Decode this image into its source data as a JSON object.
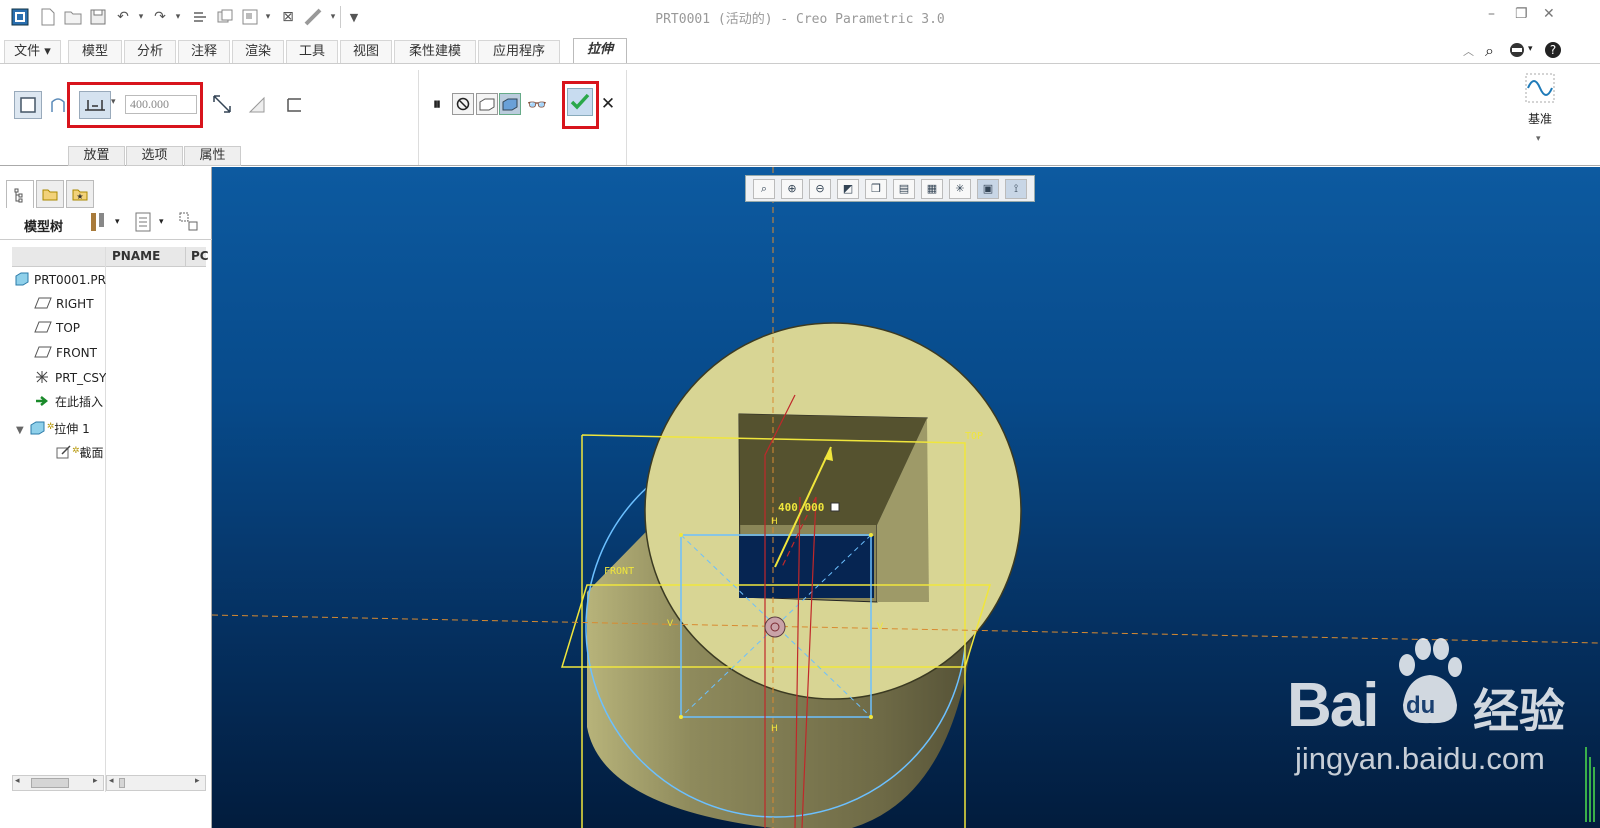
{
  "window": {
    "title": "PRT0001 (活动的) - Creo Parametric 3.0"
  },
  "tabs": [
    {
      "label": "文件 ▾"
    },
    {
      "label": "模型"
    },
    {
      "label": "分析"
    },
    {
      "label": "注释"
    },
    {
      "label": "渲染"
    },
    {
      "label": "工具"
    },
    {
      "label": "视图"
    },
    {
      "label": "柔性建模"
    },
    {
      "label": "应用程序"
    },
    {
      "label": "拉伸"
    }
  ],
  "ribbon": {
    "depth_value": "400.000",
    "group_tabs": [
      {
        "label": "放置"
      },
      {
        "label": "选项"
      },
      {
        "label": "属性"
      }
    ],
    "datum_label": "基准"
  },
  "left_panel": {
    "tree_label": "模型树",
    "columns": [
      {
        "label": "PNAME"
      },
      {
        "label": "PC"
      }
    ],
    "items": [
      {
        "label": "PRT0001.PR"
      },
      {
        "label": "RIGHT"
      },
      {
        "label": "TOP"
      },
      {
        "label": "FRONT"
      },
      {
        "label": "PRT_CSY"
      },
      {
        "label": "在此插入"
      },
      {
        "label": "拉伸 1"
      },
      {
        "label": "截面"
      }
    ]
  },
  "viewport": {
    "dimension_label": "400.000",
    "plane_labels": {
      "top": "TOP",
      "front": "FRONT"
    },
    "constraint_marks": {
      "h": "H",
      "v": "V"
    },
    "watermark": {
      "brand": "Bai",
      "du": "du",
      "cn": "经验",
      "url": "jingyan.baidu.com"
    }
  },
  "colors": {
    "highlight_red": "#d8141c",
    "viewport_top": "#0d5aa0",
    "viewport_bottom": "#021c3d",
    "model_yellow": "#d8d594",
    "sketch_yellow": "#f0e63c",
    "sketch_blue": "#6cc0ff",
    "confirm_green": "#2aa84a"
  }
}
